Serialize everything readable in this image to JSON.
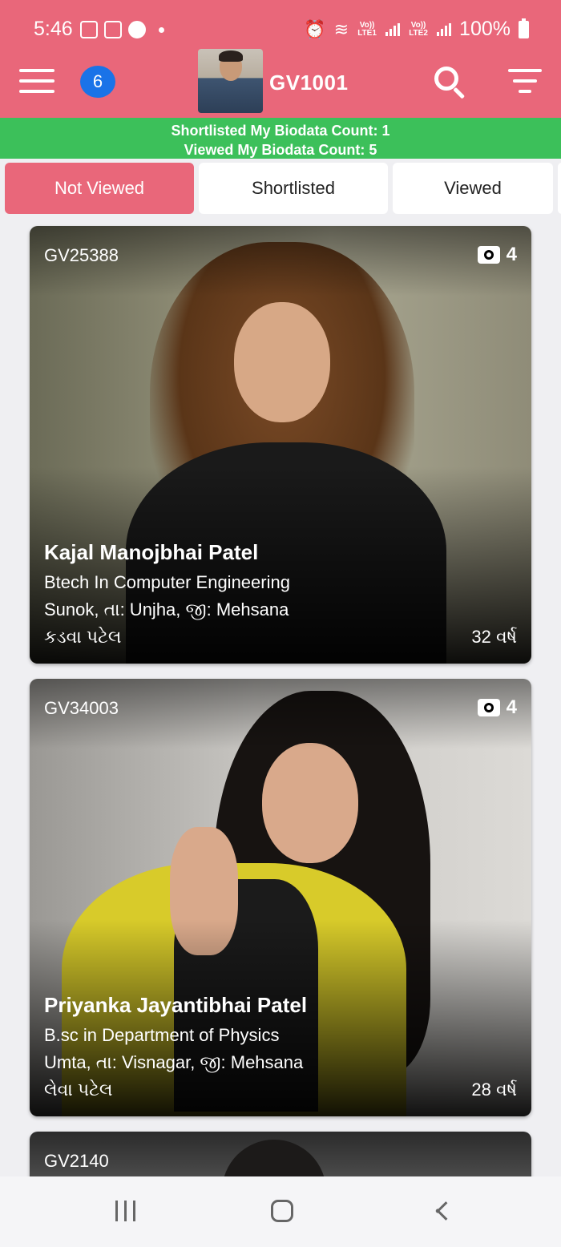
{
  "status_bar": {
    "time": "5:46",
    "signal_1": "Vo)) LTE1",
    "signal_2": "Vo)) LTE2",
    "battery": "100%"
  },
  "app_bar": {
    "notification_count": "6",
    "user_code": "GV1001",
    "icons": [
      "menu-icon",
      "search-icon",
      "filter-icon"
    ]
  },
  "counts": {
    "shortlisted": "Shortlisted My Biodata Count: 1",
    "viewed": "Viewed My Biodata Count: 5"
  },
  "tabs": [
    {
      "label": "Not Viewed",
      "active": true
    },
    {
      "label": "Shortlisted",
      "active": false
    },
    {
      "label": "Viewed",
      "active": false
    }
  ],
  "profiles": [
    {
      "code": "GV25388",
      "photo_count": "4",
      "name": "Kajal Manojbhai Patel",
      "education": "Btech In Computer Engineering",
      "location": "Sunok, તા: Unjha, જી: Mehsana",
      "community": "કડવા પટેલ",
      "age": "32 વર્ષ"
    },
    {
      "code": "GV34003",
      "photo_count": "4",
      "name": "Priyanka Jayantibhai Patel",
      "education": "B.sc in Department of Physics",
      "location": "Umta, તા: Visnagar, જી: Mehsana",
      "community": "લેવા પટેલ",
      "age": "28 વર્ષ"
    },
    {
      "code": "GV2140"
    }
  ],
  "colors": {
    "primary": "#e9677a",
    "count_bar": "#3cc05a",
    "badge": "#1a73e8"
  }
}
